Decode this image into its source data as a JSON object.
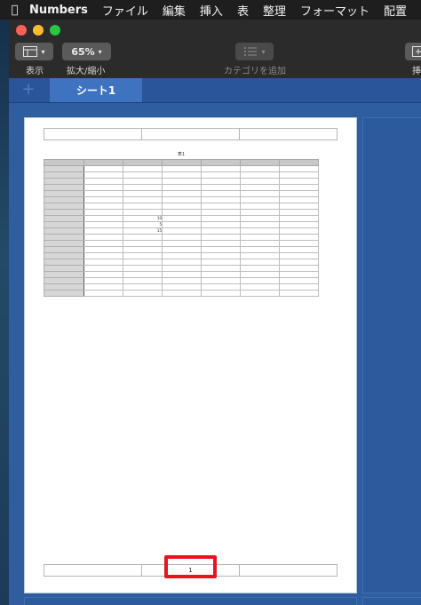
{
  "menubar": {
    "app_name": "Numbers",
    "items": [
      "ファイル",
      "編集",
      "挿入",
      "表",
      "整理",
      "フォーマット",
      "配置"
    ]
  },
  "toolbar": {
    "view_label": "表示",
    "zoom_value": "65%",
    "zoom_label": "拡大/縮小",
    "category_label": "カテゴリを追加",
    "insert_label": "挿"
  },
  "tabs": {
    "add_symbol": "+",
    "sheet_name": "シート1"
  },
  "document": {
    "table_title": "表1",
    "header_cells": [
      "",
      "",
      ""
    ],
    "footer_cells": [
      "",
      "1",
      ""
    ],
    "cell_values": {
      "r9": "10",
      "r10": "5",
      "r11": "15"
    }
  },
  "colors": {
    "accent": "#3f73c0",
    "canvas": "#2e5da0",
    "highlight": "#e8141e"
  }
}
